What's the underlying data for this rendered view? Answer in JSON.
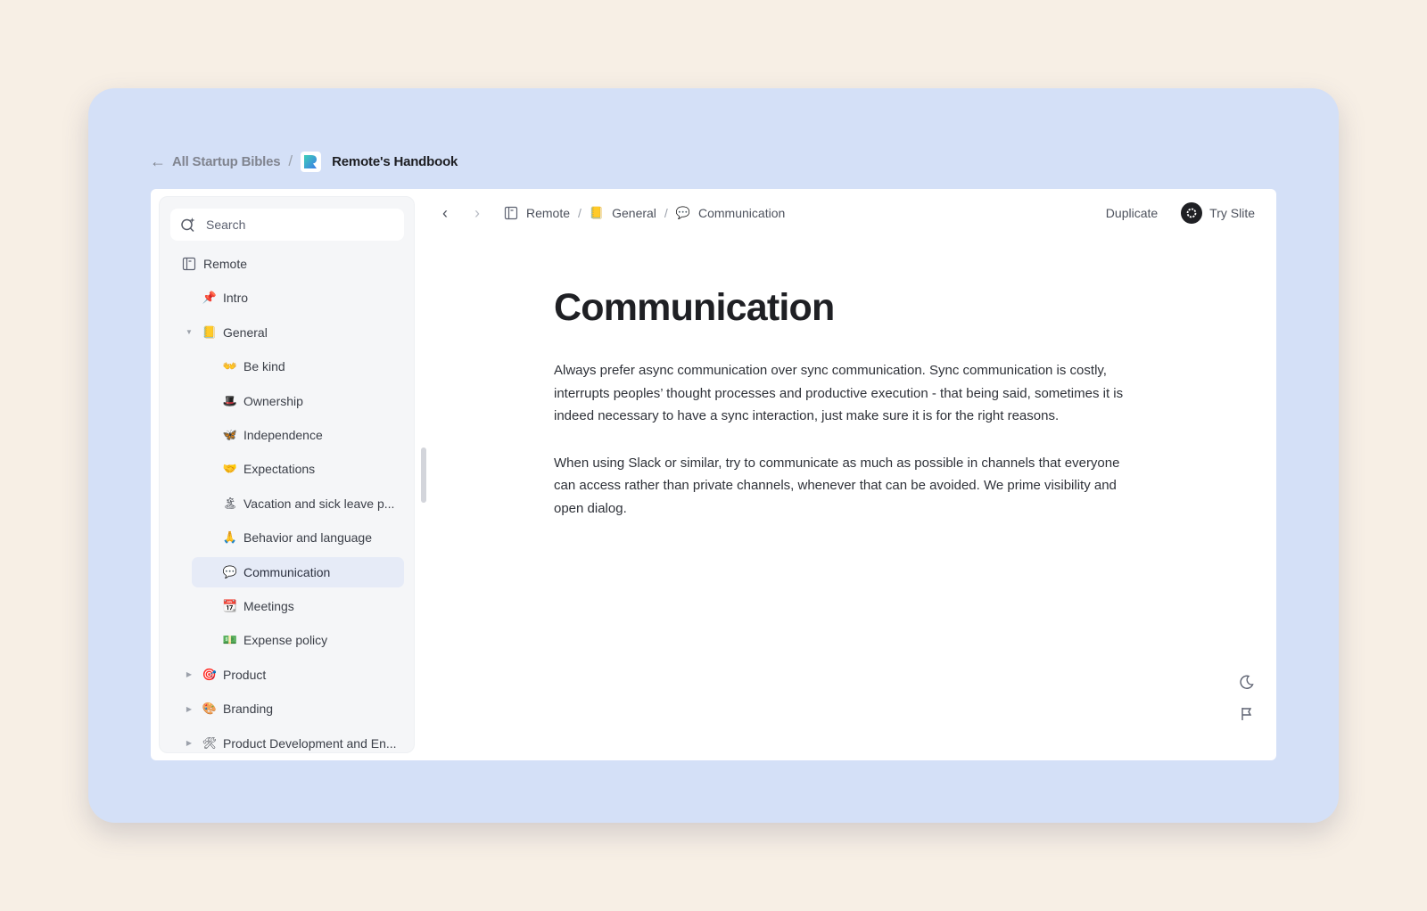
{
  "topbar": {
    "back_label": "All Startup Bibles",
    "separator": "/",
    "title": "Remote's Handbook"
  },
  "sidebar": {
    "search_placeholder": "Search",
    "items": [
      {
        "label": "Remote",
        "icon": "notebook-icon",
        "emoji": "",
        "level": 0,
        "caret": ""
      },
      {
        "label": "Intro",
        "icon": "pushpin-icon",
        "emoji": "📌",
        "level": 1,
        "caret": ""
      },
      {
        "label": "General",
        "icon": "folder-icon",
        "emoji": "📒",
        "level": 1,
        "caret": "▼"
      },
      {
        "label": "Be kind",
        "icon": "open-hands-icon",
        "emoji": "👐",
        "level": 2,
        "caret": ""
      },
      {
        "label": "Ownership",
        "icon": "top-hat-icon",
        "emoji": "🎩",
        "level": 2,
        "caret": ""
      },
      {
        "label": "Independence",
        "icon": "butterfly-icon",
        "emoji": "🦋",
        "level": 2,
        "caret": ""
      },
      {
        "label": "Expectations",
        "icon": "handshake-icon",
        "emoji": "🤝",
        "level": 2,
        "caret": ""
      },
      {
        "label": "Vacation and sick leave p...",
        "icon": "island-icon",
        "emoji": "🏝",
        "level": 2,
        "caret": ""
      },
      {
        "label": "Behavior and language",
        "icon": "folded-hands-icon",
        "emoji": "🙏",
        "level": 2,
        "caret": ""
      },
      {
        "label": "Communication",
        "icon": "speech-bubble-icon",
        "emoji": "💬",
        "level": 2,
        "caret": "",
        "active": true
      },
      {
        "label": "Meetings",
        "icon": "calendar-icon",
        "emoji": "📆",
        "level": 2,
        "caret": ""
      },
      {
        "label": "Expense policy",
        "icon": "money-icon",
        "emoji": "💵",
        "level": 2,
        "caret": ""
      },
      {
        "label": "Product",
        "icon": "target-icon",
        "emoji": "🎯",
        "level": 1,
        "caret": "▶"
      },
      {
        "label": "Branding",
        "icon": "palette-icon",
        "emoji": "🎨",
        "level": 1,
        "caret": "▶"
      },
      {
        "label": "Product Development and En...",
        "icon": "tools-icon",
        "emoji": "🛠",
        "level": 1,
        "caret": "▶"
      }
    ]
  },
  "main": {
    "breadcrumb": [
      {
        "label": "Remote",
        "icon": "notebook-icon",
        "emoji": ""
      },
      {
        "label": "General",
        "icon": "folder-icon",
        "emoji": "📒"
      },
      {
        "label": "Communication",
        "icon": "speech-bubble-icon",
        "emoji": "💬"
      }
    ],
    "breadcrumb_separator": "/",
    "actions": {
      "duplicate_label": "Duplicate",
      "try_label": "Try Slite"
    },
    "doc": {
      "title": "Communication",
      "paragraphs": [
        "Always prefer async communication over sync communication. Sync communication is costly, interrupts peoples’ thought processes and productive execution - that being said, sometimes it is indeed necessary to have a sync interaction, just make sure it is for the right reasons.",
        "When using Slack or similar, try to communicate as much as possible in channels that everyone can access rather than private channels, whenever that can be avoided. We prime visibility and open dialog."
      ]
    }
  }
}
